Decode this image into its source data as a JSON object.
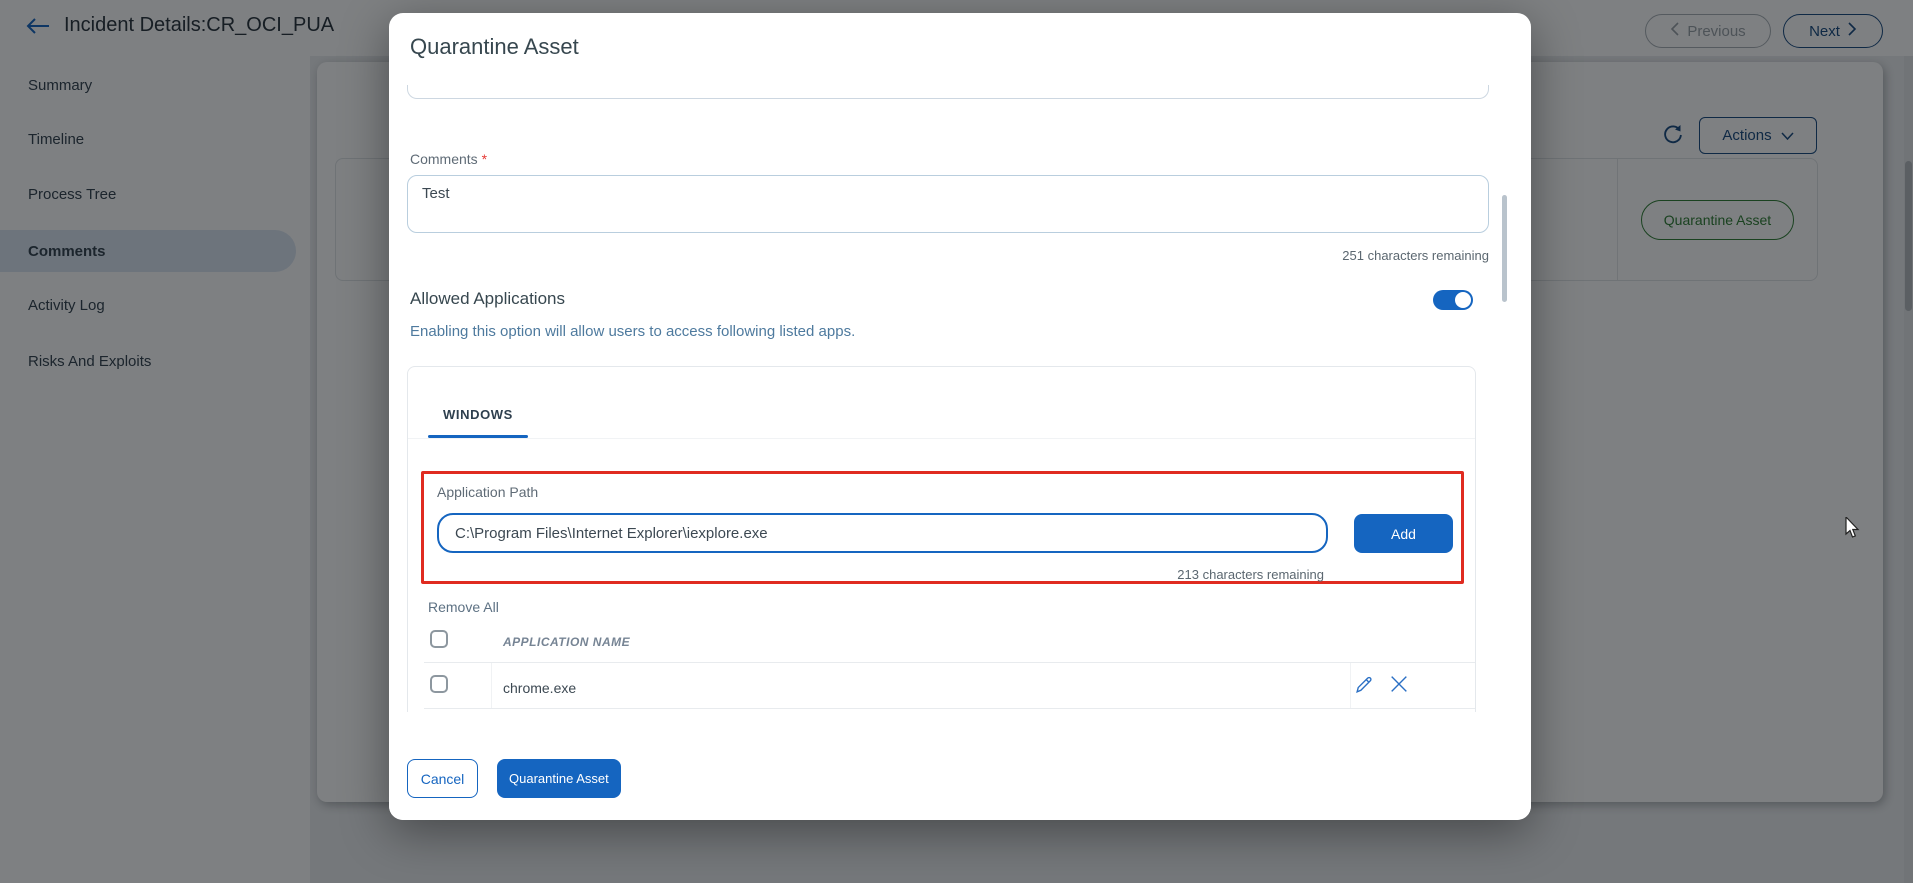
{
  "page": {
    "title": "Incident Details:CR_OCI_PUA"
  },
  "topbar": {
    "previous_label": "Previous",
    "next_label": "Next"
  },
  "sidebar": {
    "items": [
      {
        "label": "Summary",
        "active": false
      },
      {
        "label": "Timeline",
        "active": false
      },
      {
        "label": "Process Tree",
        "active": false
      },
      {
        "label": "Comments",
        "active": true
      },
      {
        "label": "Activity Log",
        "active": false
      },
      {
        "label": "Risks And Exploits",
        "active": false
      }
    ]
  },
  "content": {
    "actions_label": "Actions",
    "quarantine_pill_label": "Quarantine Asset"
  },
  "modal": {
    "title": "Quarantine Asset",
    "comments": {
      "label": "Comments",
      "required_mark": "*",
      "value": "Test",
      "remaining": "251 characters remaining"
    },
    "allowed_apps": {
      "heading": "Allowed Applications",
      "description": "Enabling this option will allow users to access following listed apps.",
      "toggle_on": true
    },
    "tab_label": "WINDOWS",
    "app_path": {
      "label": "Application Path",
      "value": "C:\\Program Files\\Internet Explorer\\iexplore.exe",
      "add_label": "Add",
      "remaining": "213 characters remaining"
    },
    "list": {
      "remove_all_label": "Remove All",
      "column_header": "APPLICATION NAME",
      "rows": [
        {
          "name": "chrome.exe"
        }
      ]
    },
    "footer": {
      "cancel_label": "Cancel",
      "submit_label": "Quarantine Asset"
    }
  },
  "icons": [
    "back-arrow-icon",
    "chevron-left-icon",
    "chevron-right-icon",
    "chevron-down-icon",
    "refresh-icon",
    "toggle-switch",
    "checkbox",
    "edit-pencil-icon",
    "delete-x-icon",
    "mouse-cursor"
  ],
  "colors": {
    "accent": "#1565c0",
    "danger": "#e02b20",
    "success_green": "#2e7d32",
    "navy": "#17497f"
  }
}
